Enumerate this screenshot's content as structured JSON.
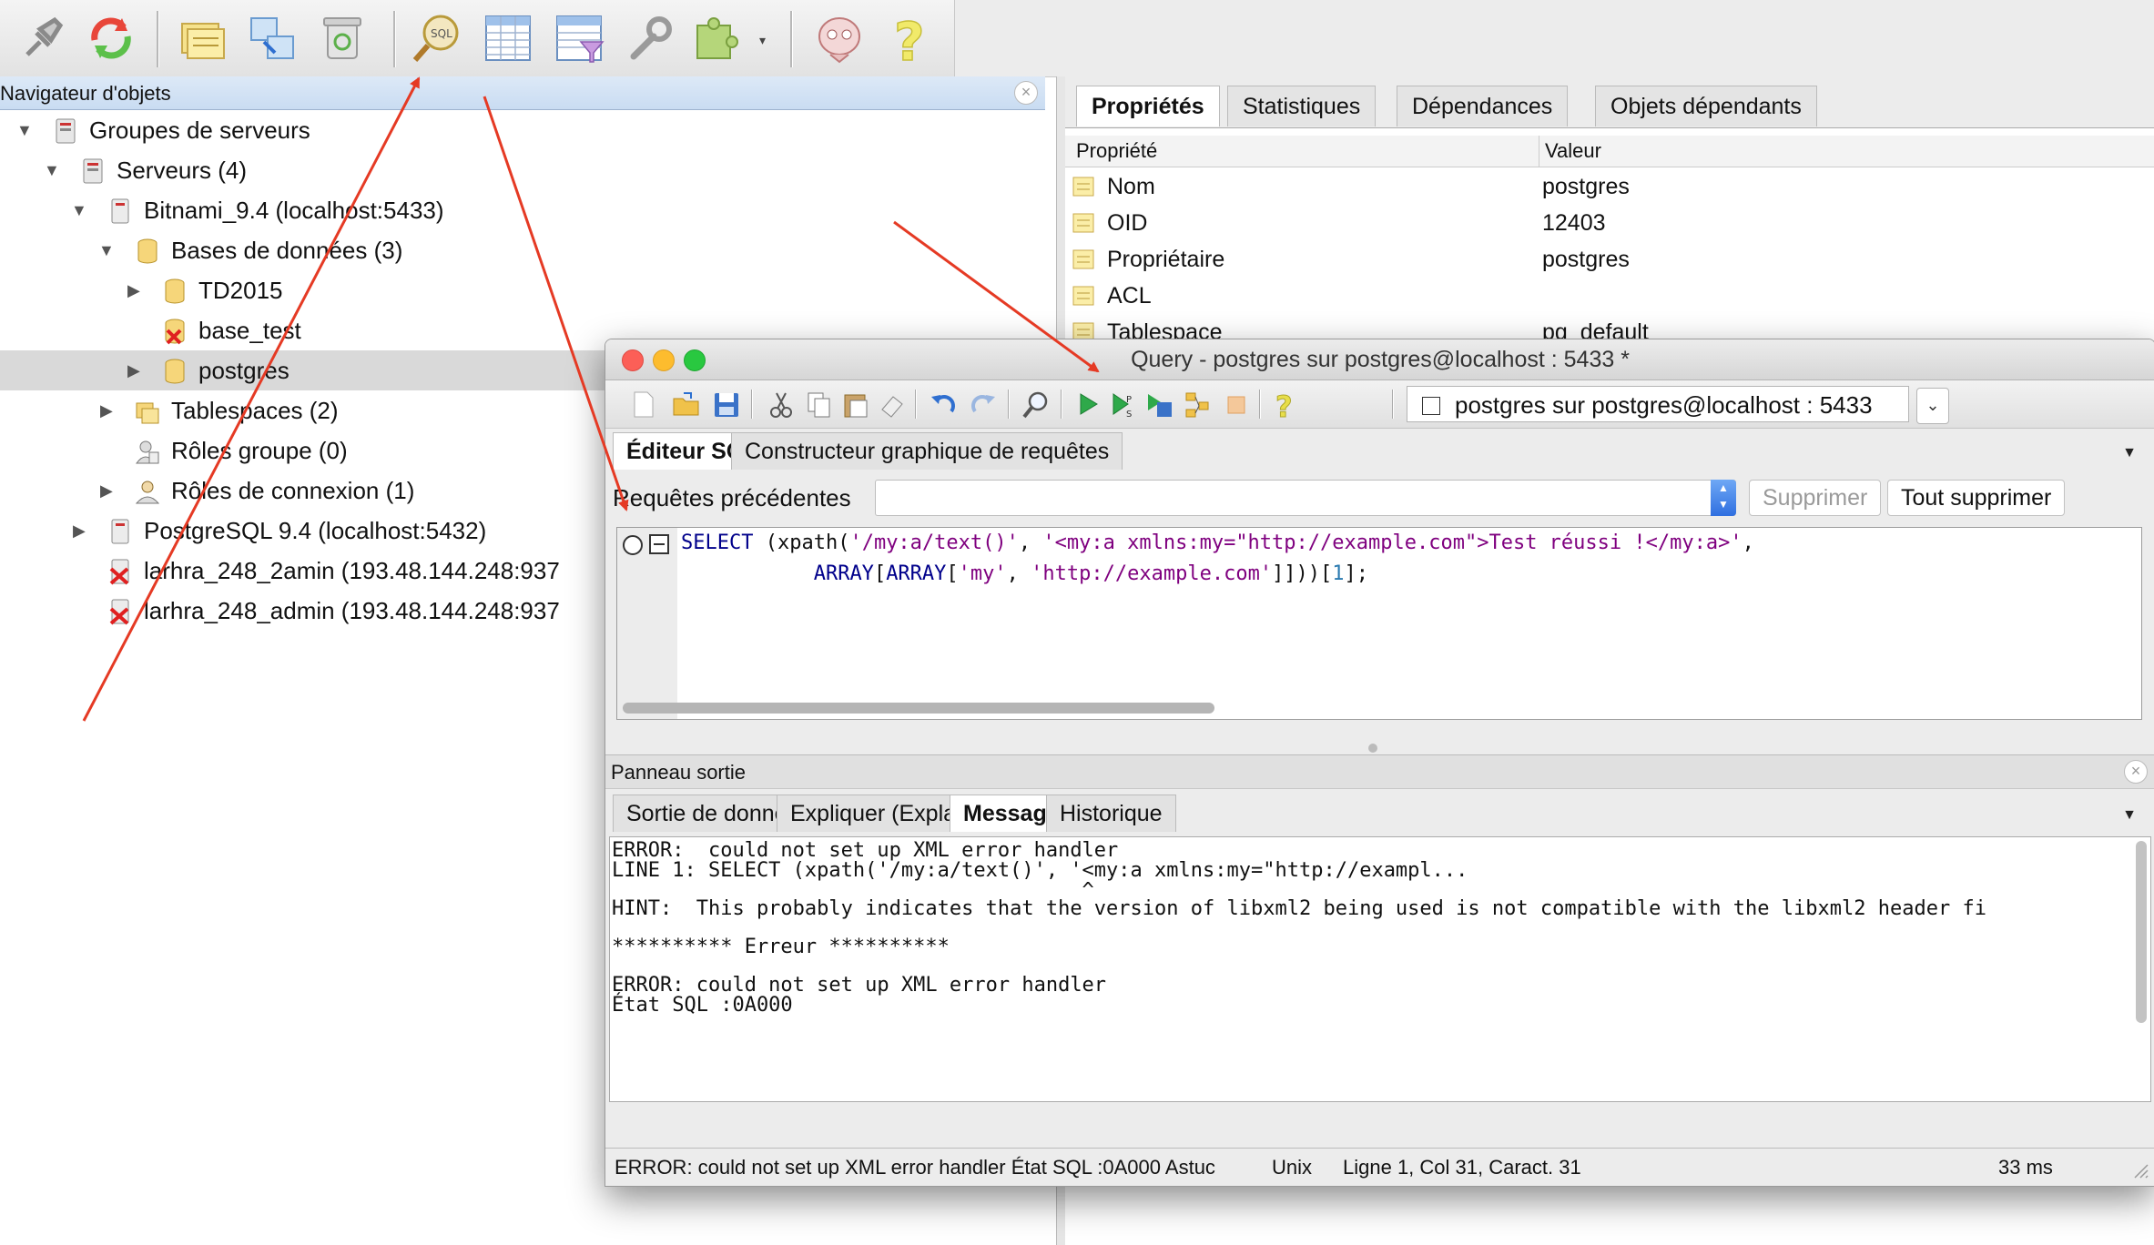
{
  "object_browser": {
    "title": "Navigateur d'objets",
    "tree": [
      {
        "label": "Groupes de serveurs",
        "expanded": true
      },
      {
        "label": "Serveurs (4)",
        "expanded": true
      },
      {
        "label": "Bitnami_9.4 (localhost:5433)",
        "expanded": true
      },
      {
        "label": "Bases de données (3)",
        "expanded": true
      },
      {
        "label": "TD2015",
        "expanded": false
      },
      {
        "label": "base_test"
      },
      {
        "label": "postgres",
        "expanded": false,
        "selected": true
      },
      {
        "label": "Tablespaces (2)",
        "expanded": false
      },
      {
        "label": "Rôles groupe (0)"
      },
      {
        "label": "Rôles de connexion (1)",
        "expanded": false
      },
      {
        "label": "PostgreSQL 9.4 (localhost:5432)",
        "expanded": false
      },
      {
        "label": "larhra_248_2amin (193.48.144.248:937"
      },
      {
        "label": "larhra_248_admin (193.48.144.248:937"
      }
    ]
  },
  "properties": {
    "tabs": [
      "Propriétés",
      "Statistiques",
      "Dépendances",
      "Objets dépendants"
    ],
    "columns": [
      "Propriété",
      "Valeur"
    ],
    "rows": [
      {
        "name": "Nom",
        "value": "postgres"
      },
      {
        "name": "OID",
        "value": "12403"
      },
      {
        "name": "Propriétaire",
        "value": "postgres"
      },
      {
        "name": "ACL",
        "value": ""
      },
      {
        "name": "Tablespace",
        "value": "pg_default"
      }
    ]
  },
  "query_window": {
    "title": "Query - postgres sur postgres@localhost : 5433 *",
    "connection": "postgres sur postgres@localhost : 5433",
    "tabs": [
      "Éditeur SQL",
      "Constructeur graphique de requêtes"
    ],
    "previous_label": "Requêtes précédentes",
    "delete_label": "Supprimer",
    "delete_all_label": "Tout supprimer",
    "sql": {
      "line1": {
        "kw1": "SELECT",
        "p1": " (xpath(",
        "s1": "'/my:a/text()'",
        "p2": ", ",
        "s2": "'<my:a xmlns:my=\"http://example.com\">Test réussi !</my:a>'",
        "p3": ","
      },
      "line2": {
        "kw1": "ARRAY",
        "p1": "[",
        "kw2": "ARRAY",
        "p2": "[",
        "s1": "'my'",
        "p3": ", ",
        "s2": "'http://example.com'",
        "p4": "]]))[",
        "n1": "1",
        "p5": "];"
      }
    },
    "output": {
      "title": "Panneau sortie",
      "tabs": [
        "Sortie de données",
        "Expliquer (Explain)",
        "Messages",
        "Historique"
      ],
      "lines": [
        "ERROR:  could not set up XML error handler",
        "LINE 1: SELECT (xpath('/my:a/text()', '<my:a xmlns:my=\"http://exampl...",
        "                                       ^",
        "HINT:  This probably indicates that the version of libxml2 being used is not compatible with the libxml2 header fi",
        "",
        "********** Erreur **********",
        "",
        "ERROR: could not set up XML error handler",
        "État SQL :0A000"
      ]
    },
    "status": {
      "message": "ERROR: could not set up XML error handler État SQL :0A000 Astuc",
      "line_endings": "Unix",
      "position": "Ligne 1, Col 31, Caract. 31",
      "duration": "33 ms"
    }
  }
}
